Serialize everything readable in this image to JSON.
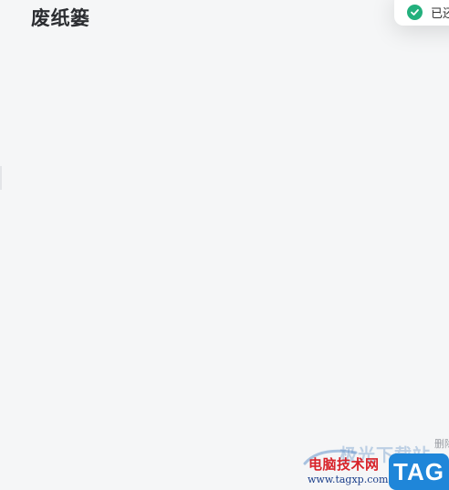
{
  "header": {
    "title": "废纸篓"
  },
  "toast": {
    "icon": "check-circle-icon",
    "text": "已还原",
    "color": "#23b07d"
  },
  "corner": {
    "text": "删除"
  },
  "watermark": {
    "faded_text": "极光下载站",
    "site_name": "电脑技术网",
    "url": "www.tagxp.com",
    "badge": "TAG",
    "badge_color": "#1f86d9",
    "name_color": "#d8232a"
  }
}
